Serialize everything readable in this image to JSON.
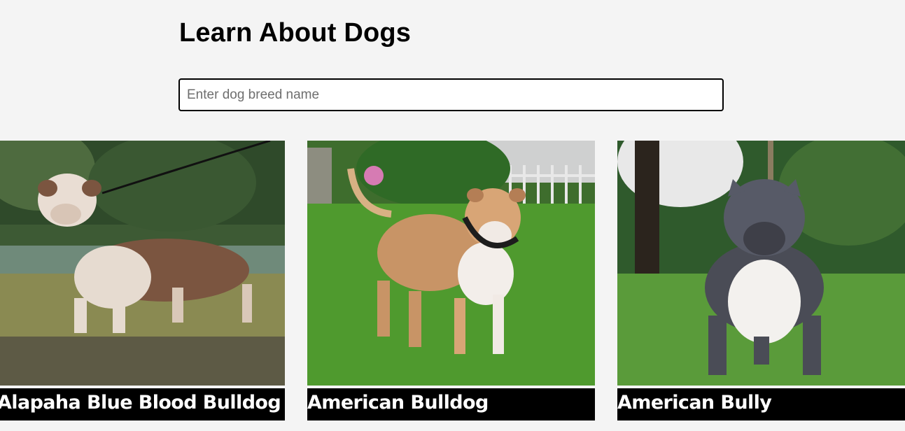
{
  "header": {
    "title": "Learn About Dogs"
  },
  "search": {
    "placeholder": "Enter dog breed name",
    "value": ""
  },
  "breeds": [
    {
      "name": "Alapaha Blue Blood Bulldog",
      "image_icon": "dog-photo"
    },
    {
      "name": "American Bulldog",
      "image_icon": "dog-photo"
    },
    {
      "name": "American Bully",
      "image_icon": "dog-photo"
    }
  ],
  "colors": {
    "background": "#f4f4f4",
    "caption_bg": "#000000",
    "caption_text": "#ffffff",
    "grass": "#4f9a2e"
  }
}
